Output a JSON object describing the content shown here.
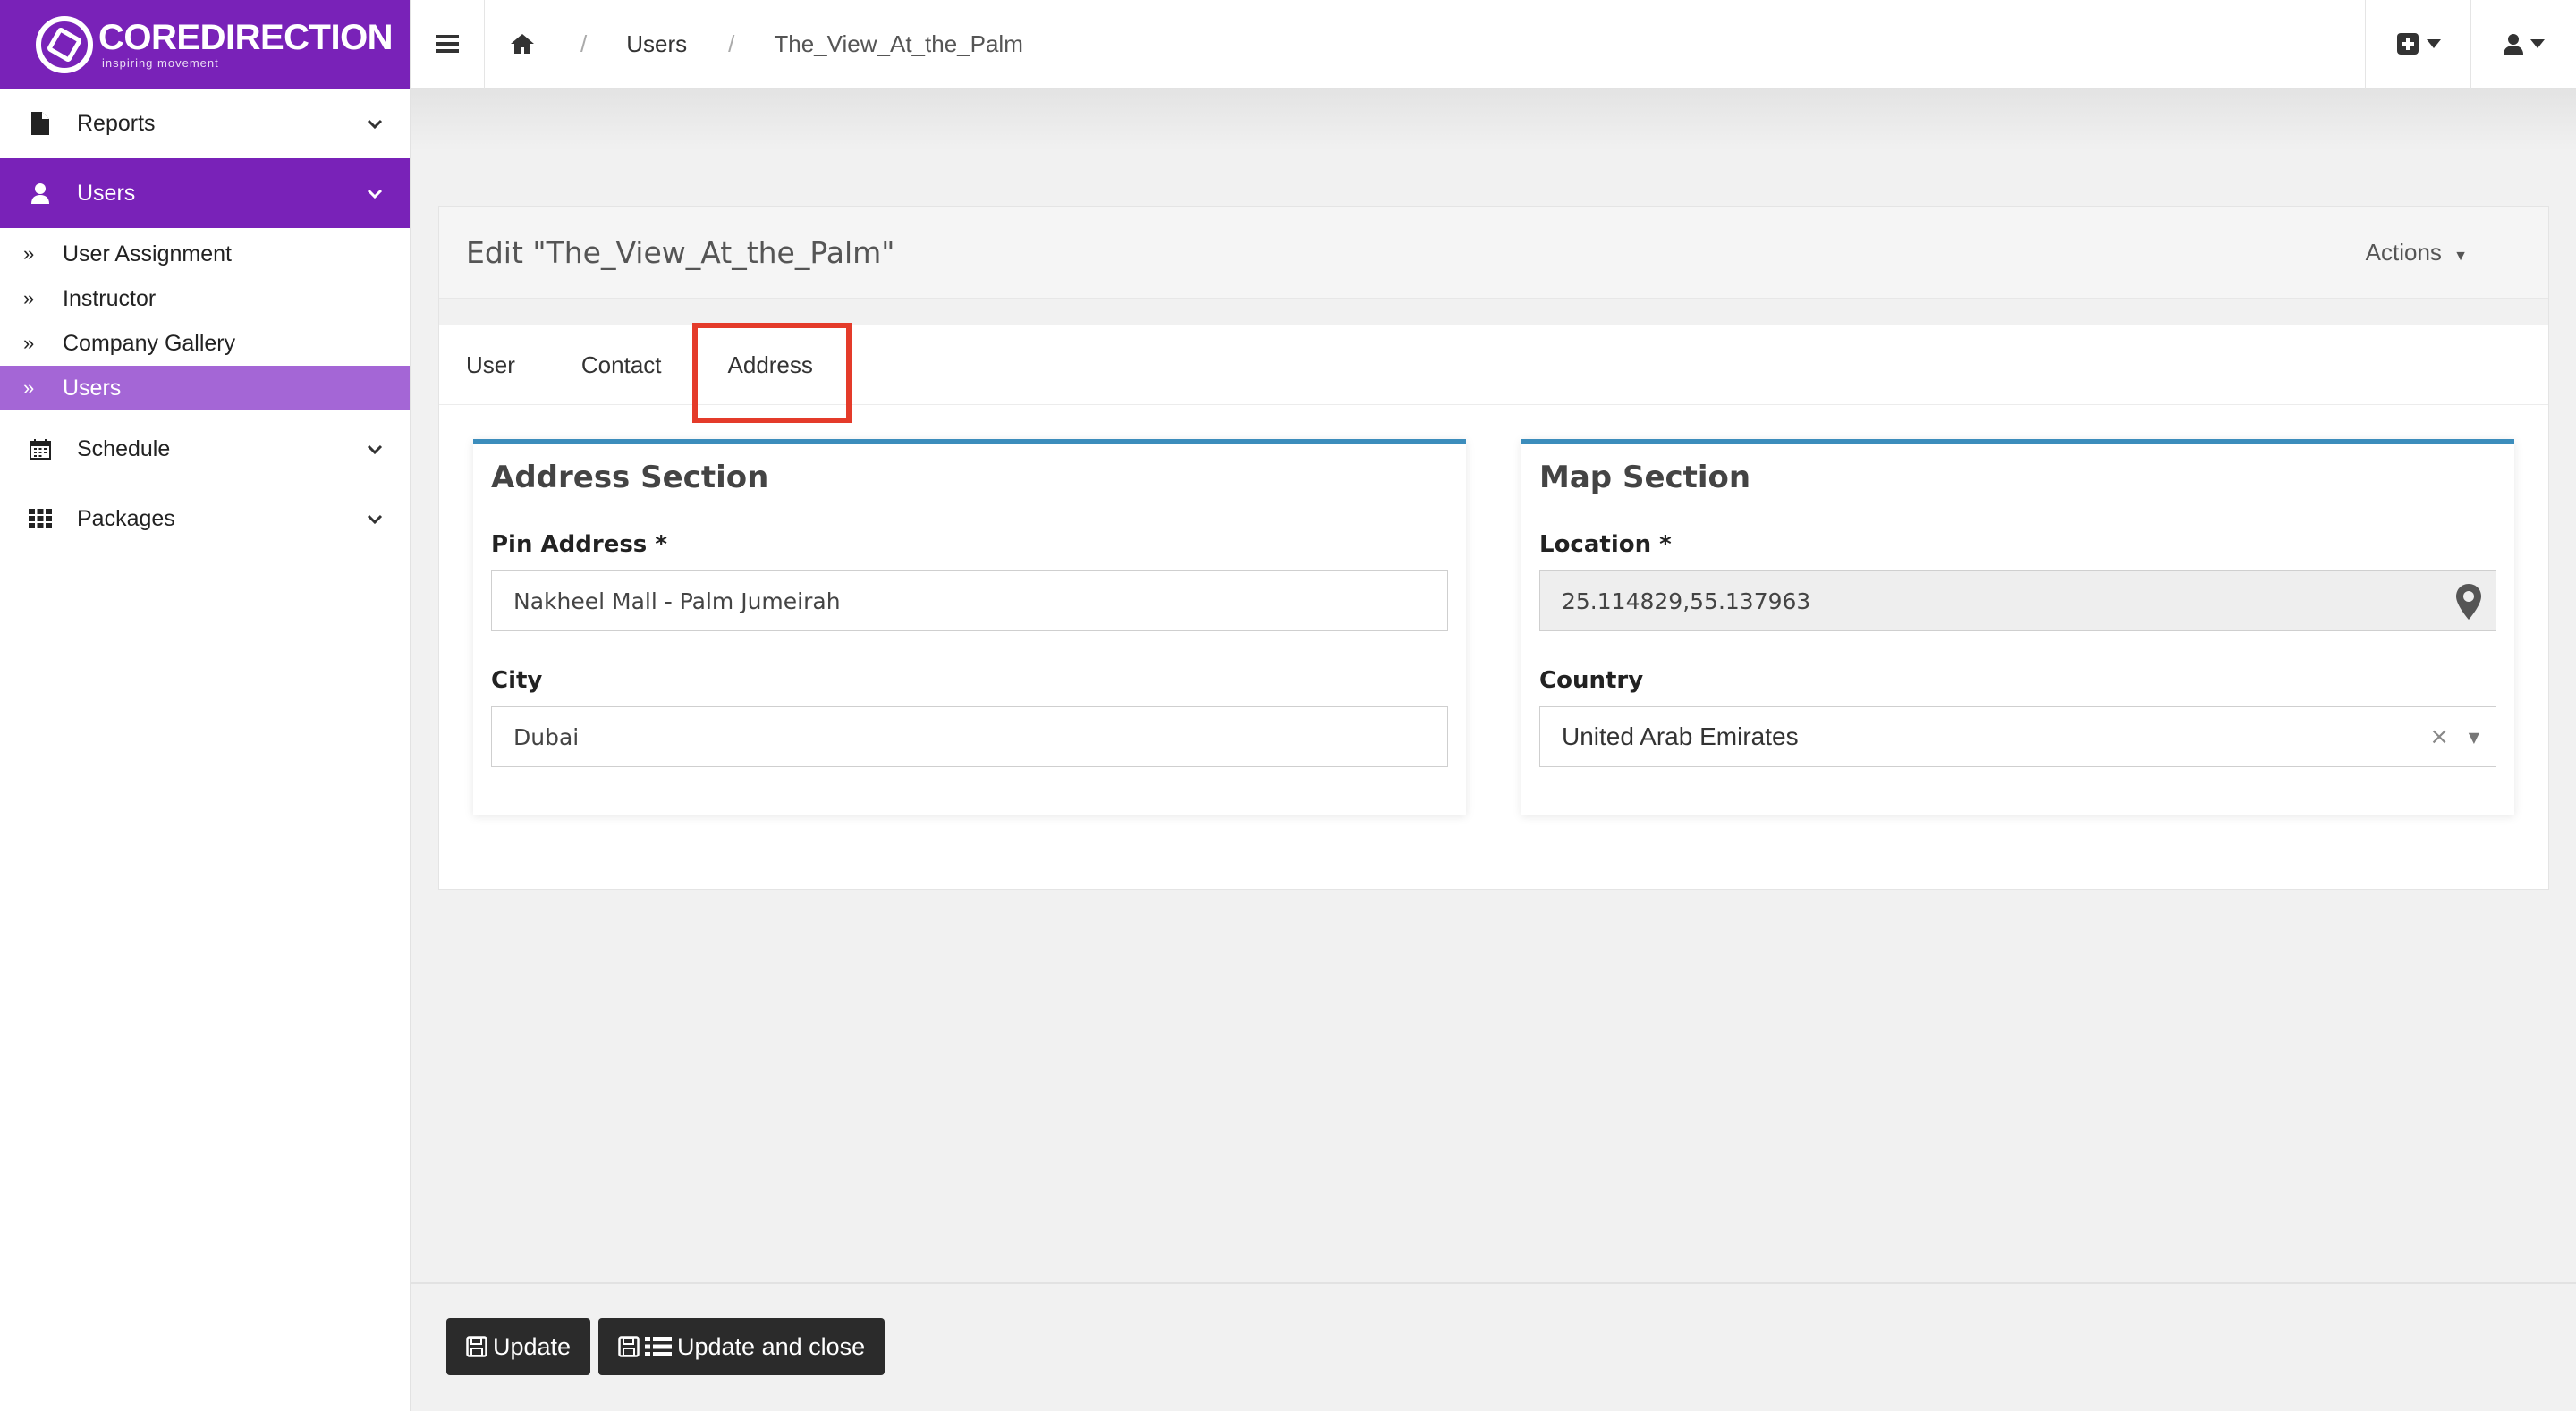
{
  "brand": {
    "name": "COREDIRECTION",
    "tagline": "inspiring movement",
    "color": "#7922b8"
  },
  "sidebar": {
    "items": [
      {
        "label": "Reports",
        "icon": "file-icon"
      },
      {
        "label": "Users",
        "icon": "user-icon",
        "active": true,
        "children": [
          {
            "label": "User Assignment"
          },
          {
            "label": "Instructor"
          },
          {
            "label": "Company Gallery"
          },
          {
            "label": "Users",
            "active": true
          }
        ]
      },
      {
        "label": "Schedule",
        "icon": "calendar-icon"
      },
      {
        "label": "Packages",
        "icon": "grid-icon"
      }
    ]
  },
  "breadcrumb": {
    "sep": "/",
    "items": [
      "Users",
      "The_View_At_the_Palm"
    ]
  },
  "panel": {
    "title": "Edit \"The_View_At_the_Palm\"",
    "actions_label": "Actions"
  },
  "tabs": [
    "User",
    "Contact",
    "Address"
  ],
  "active_tab": "Address",
  "address_section": {
    "title": "Address Section",
    "pin_label": "Pin Address *",
    "pin_value": "Nakheel Mall - Palm Jumeirah",
    "city_label": "City",
    "city_value": "Dubai"
  },
  "map_section": {
    "title": "Map Section",
    "location_label": "Location *",
    "location_value": "25.114829,55.137963",
    "country_label": "Country",
    "country_value": "United Arab Emirates",
    "clear_glyph": "×"
  },
  "footer": {
    "update_label": "Update",
    "update_close_label": "Update and close"
  },
  "colors": {
    "accent_border": "#3c8dbc",
    "highlight": "#e43b2a",
    "sub_active": "#a466d6"
  }
}
